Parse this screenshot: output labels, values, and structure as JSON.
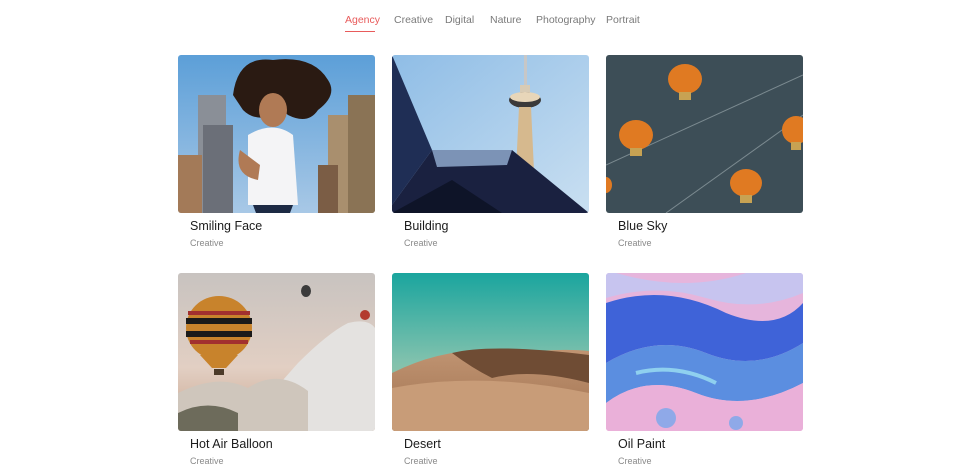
{
  "filters": {
    "items": [
      {
        "label": "Agency",
        "active": true
      },
      {
        "label": "Creative",
        "active": false
      },
      {
        "label": "Digital",
        "active": false
      },
      {
        "label": "Nature",
        "active": false
      },
      {
        "label": "Photography",
        "active": false
      },
      {
        "label": "Portrait",
        "active": false
      }
    ]
  },
  "portfolio": {
    "items": [
      {
        "title": "Smiling Face",
        "category": "Creative",
        "image": "woman-city-photo"
      },
      {
        "title": "Building",
        "category": "Creative",
        "image": "tower-photo"
      },
      {
        "title": "Blue Sky",
        "category": "Creative",
        "image": "lanterns-photo"
      },
      {
        "title": "Hot Air Balloon",
        "category": "Creative",
        "image": "balloon-photo"
      },
      {
        "title": "Desert",
        "category": "Creative",
        "image": "desert-photo"
      },
      {
        "title": "Oil Paint",
        "category": "Creative",
        "image": "paint-photo"
      }
    ]
  },
  "colors": {
    "accent": "#e85b5b",
    "text": "#1c1c1c",
    "muted": "#8a8a8a"
  }
}
